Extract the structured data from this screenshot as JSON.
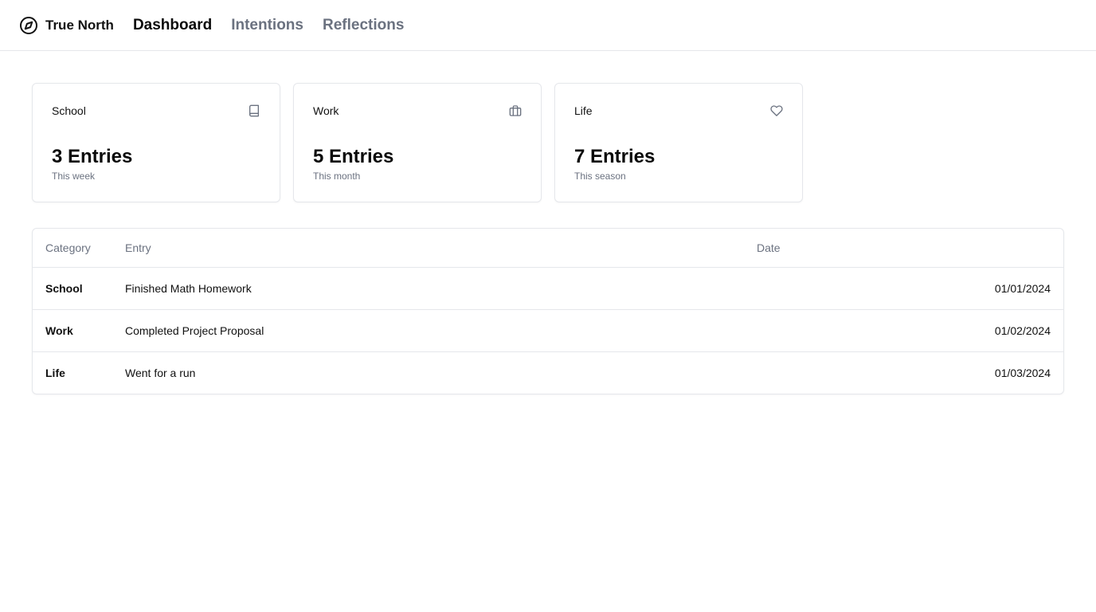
{
  "app": {
    "name": "True North"
  },
  "nav": [
    {
      "label": "Dashboard",
      "active": true
    },
    {
      "label": "Intentions",
      "active": false
    },
    {
      "label": "Reflections",
      "active": false
    }
  ],
  "cards": [
    {
      "title": "School",
      "icon": "book-icon",
      "value": "3 Entries",
      "sub": "This week"
    },
    {
      "title": "Work",
      "icon": "briefcase-icon",
      "value": "5 Entries",
      "sub": "This month"
    },
    {
      "title": "Life",
      "icon": "heart-icon",
      "value": "7 Entries",
      "sub": "This season"
    }
  ],
  "table": {
    "headers": {
      "category": "Category",
      "entry": "Entry",
      "date": "Date"
    },
    "rows": [
      {
        "category": "School",
        "entry": "Finished Math Homework",
        "date": "01/01/2024"
      },
      {
        "category": "Work",
        "entry": "Completed Project Proposal",
        "date": "01/02/2024"
      },
      {
        "category": "Life",
        "entry": "Went for a run",
        "date": "01/03/2024"
      }
    ]
  },
  "colors": {
    "text": "#0a0a0a",
    "muted": "#6b7280",
    "border": "#e5e7eb"
  }
}
